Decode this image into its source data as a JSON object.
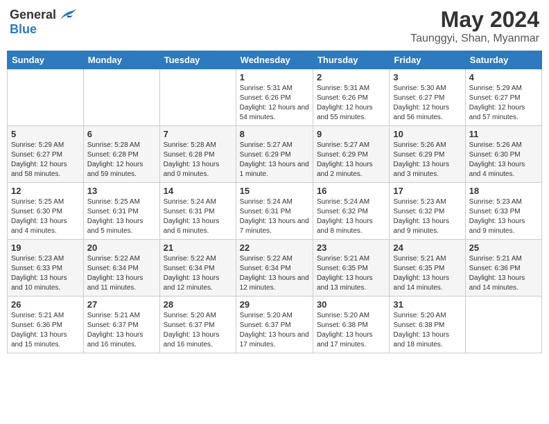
{
  "header": {
    "logo_general": "General",
    "logo_blue": "Blue",
    "main_title": "May 2024",
    "subtitle": "Taunggyi, Shan, Myanmar"
  },
  "weekdays": [
    "Sunday",
    "Monday",
    "Tuesday",
    "Wednesday",
    "Thursday",
    "Friday",
    "Saturday"
  ],
  "weeks": [
    [
      {
        "day": "",
        "info": ""
      },
      {
        "day": "",
        "info": ""
      },
      {
        "day": "",
        "info": ""
      },
      {
        "day": "1",
        "info": "Sunrise: 5:31 AM\nSunset: 6:26 PM\nDaylight: 12 hours and 54 minutes."
      },
      {
        "day": "2",
        "info": "Sunrise: 5:31 AM\nSunset: 6:26 PM\nDaylight: 12 hours and 55 minutes."
      },
      {
        "day": "3",
        "info": "Sunrise: 5:30 AM\nSunset: 6:27 PM\nDaylight: 12 hours and 56 minutes."
      },
      {
        "day": "4",
        "info": "Sunrise: 5:29 AM\nSunset: 6:27 PM\nDaylight: 12 hours and 57 minutes."
      }
    ],
    [
      {
        "day": "5",
        "info": "Sunrise: 5:29 AM\nSunset: 6:27 PM\nDaylight: 12 hours and 58 minutes."
      },
      {
        "day": "6",
        "info": "Sunrise: 5:28 AM\nSunset: 6:28 PM\nDaylight: 12 hours and 59 minutes."
      },
      {
        "day": "7",
        "info": "Sunrise: 5:28 AM\nSunset: 6:28 PM\nDaylight: 13 hours and 0 minutes."
      },
      {
        "day": "8",
        "info": "Sunrise: 5:27 AM\nSunset: 6:29 PM\nDaylight: 13 hours and 1 minute."
      },
      {
        "day": "9",
        "info": "Sunrise: 5:27 AM\nSunset: 6:29 PM\nDaylight: 13 hours and 2 minutes."
      },
      {
        "day": "10",
        "info": "Sunrise: 5:26 AM\nSunset: 6:29 PM\nDaylight: 13 hours and 3 minutes."
      },
      {
        "day": "11",
        "info": "Sunrise: 5:26 AM\nSunset: 6:30 PM\nDaylight: 13 hours and 4 minutes."
      }
    ],
    [
      {
        "day": "12",
        "info": "Sunrise: 5:25 AM\nSunset: 6:30 PM\nDaylight: 13 hours and 4 minutes."
      },
      {
        "day": "13",
        "info": "Sunrise: 5:25 AM\nSunset: 6:31 PM\nDaylight: 13 hours and 5 minutes."
      },
      {
        "day": "14",
        "info": "Sunrise: 5:24 AM\nSunset: 6:31 PM\nDaylight: 13 hours and 6 minutes."
      },
      {
        "day": "15",
        "info": "Sunrise: 5:24 AM\nSunset: 6:31 PM\nDaylight: 13 hours and 7 minutes."
      },
      {
        "day": "16",
        "info": "Sunrise: 5:24 AM\nSunset: 6:32 PM\nDaylight: 13 hours and 8 minutes."
      },
      {
        "day": "17",
        "info": "Sunrise: 5:23 AM\nSunset: 6:32 PM\nDaylight: 13 hours and 9 minutes."
      },
      {
        "day": "18",
        "info": "Sunrise: 5:23 AM\nSunset: 6:33 PM\nDaylight: 13 hours and 9 minutes."
      }
    ],
    [
      {
        "day": "19",
        "info": "Sunrise: 5:23 AM\nSunset: 6:33 PM\nDaylight: 13 hours and 10 minutes."
      },
      {
        "day": "20",
        "info": "Sunrise: 5:22 AM\nSunset: 6:34 PM\nDaylight: 13 hours and 11 minutes."
      },
      {
        "day": "21",
        "info": "Sunrise: 5:22 AM\nSunset: 6:34 PM\nDaylight: 13 hours and 12 minutes."
      },
      {
        "day": "22",
        "info": "Sunrise: 5:22 AM\nSunset: 6:34 PM\nDaylight: 13 hours and 12 minutes."
      },
      {
        "day": "23",
        "info": "Sunrise: 5:21 AM\nSunset: 6:35 PM\nDaylight: 13 hours and 13 minutes."
      },
      {
        "day": "24",
        "info": "Sunrise: 5:21 AM\nSunset: 6:35 PM\nDaylight: 13 hours and 14 minutes."
      },
      {
        "day": "25",
        "info": "Sunrise: 5:21 AM\nSunset: 6:36 PM\nDaylight: 13 hours and 14 minutes."
      }
    ],
    [
      {
        "day": "26",
        "info": "Sunrise: 5:21 AM\nSunset: 6:36 PM\nDaylight: 13 hours and 15 minutes."
      },
      {
        "day": "27",
        "info": "Sunrise: 5:21 AM\nSunset: 6:37 PM\nDaylight: 13 hours and 16 minutes."
      },
      {
        "day": "28",
        "info": "Sunrise: 5:20 AM\nSunset: 6:37 PM\nDaylight: 13 hours and 16 minutes."
      },
      {
        "day": "29",
        "info": "Sunrise: 5:20 AM\nSunset: 6:37 PM\nDaylight: 13 hours and 17 minutes."
      },
      {
        "day": "30",
        "info": "Sunrise: 5:20 AM\nSunset: 6:38 PM\nDaylight: 13 hours and 17 minutes."
      },
      {
        "day": "31",
        "info": "Sunrise: 5:20 AM\nSunset: 6:38 PM\nDaylight: 13 hours and 18 minutes."
      },
      {
        "day": "",
        "info": ""
      }
    ]
  ]
}
